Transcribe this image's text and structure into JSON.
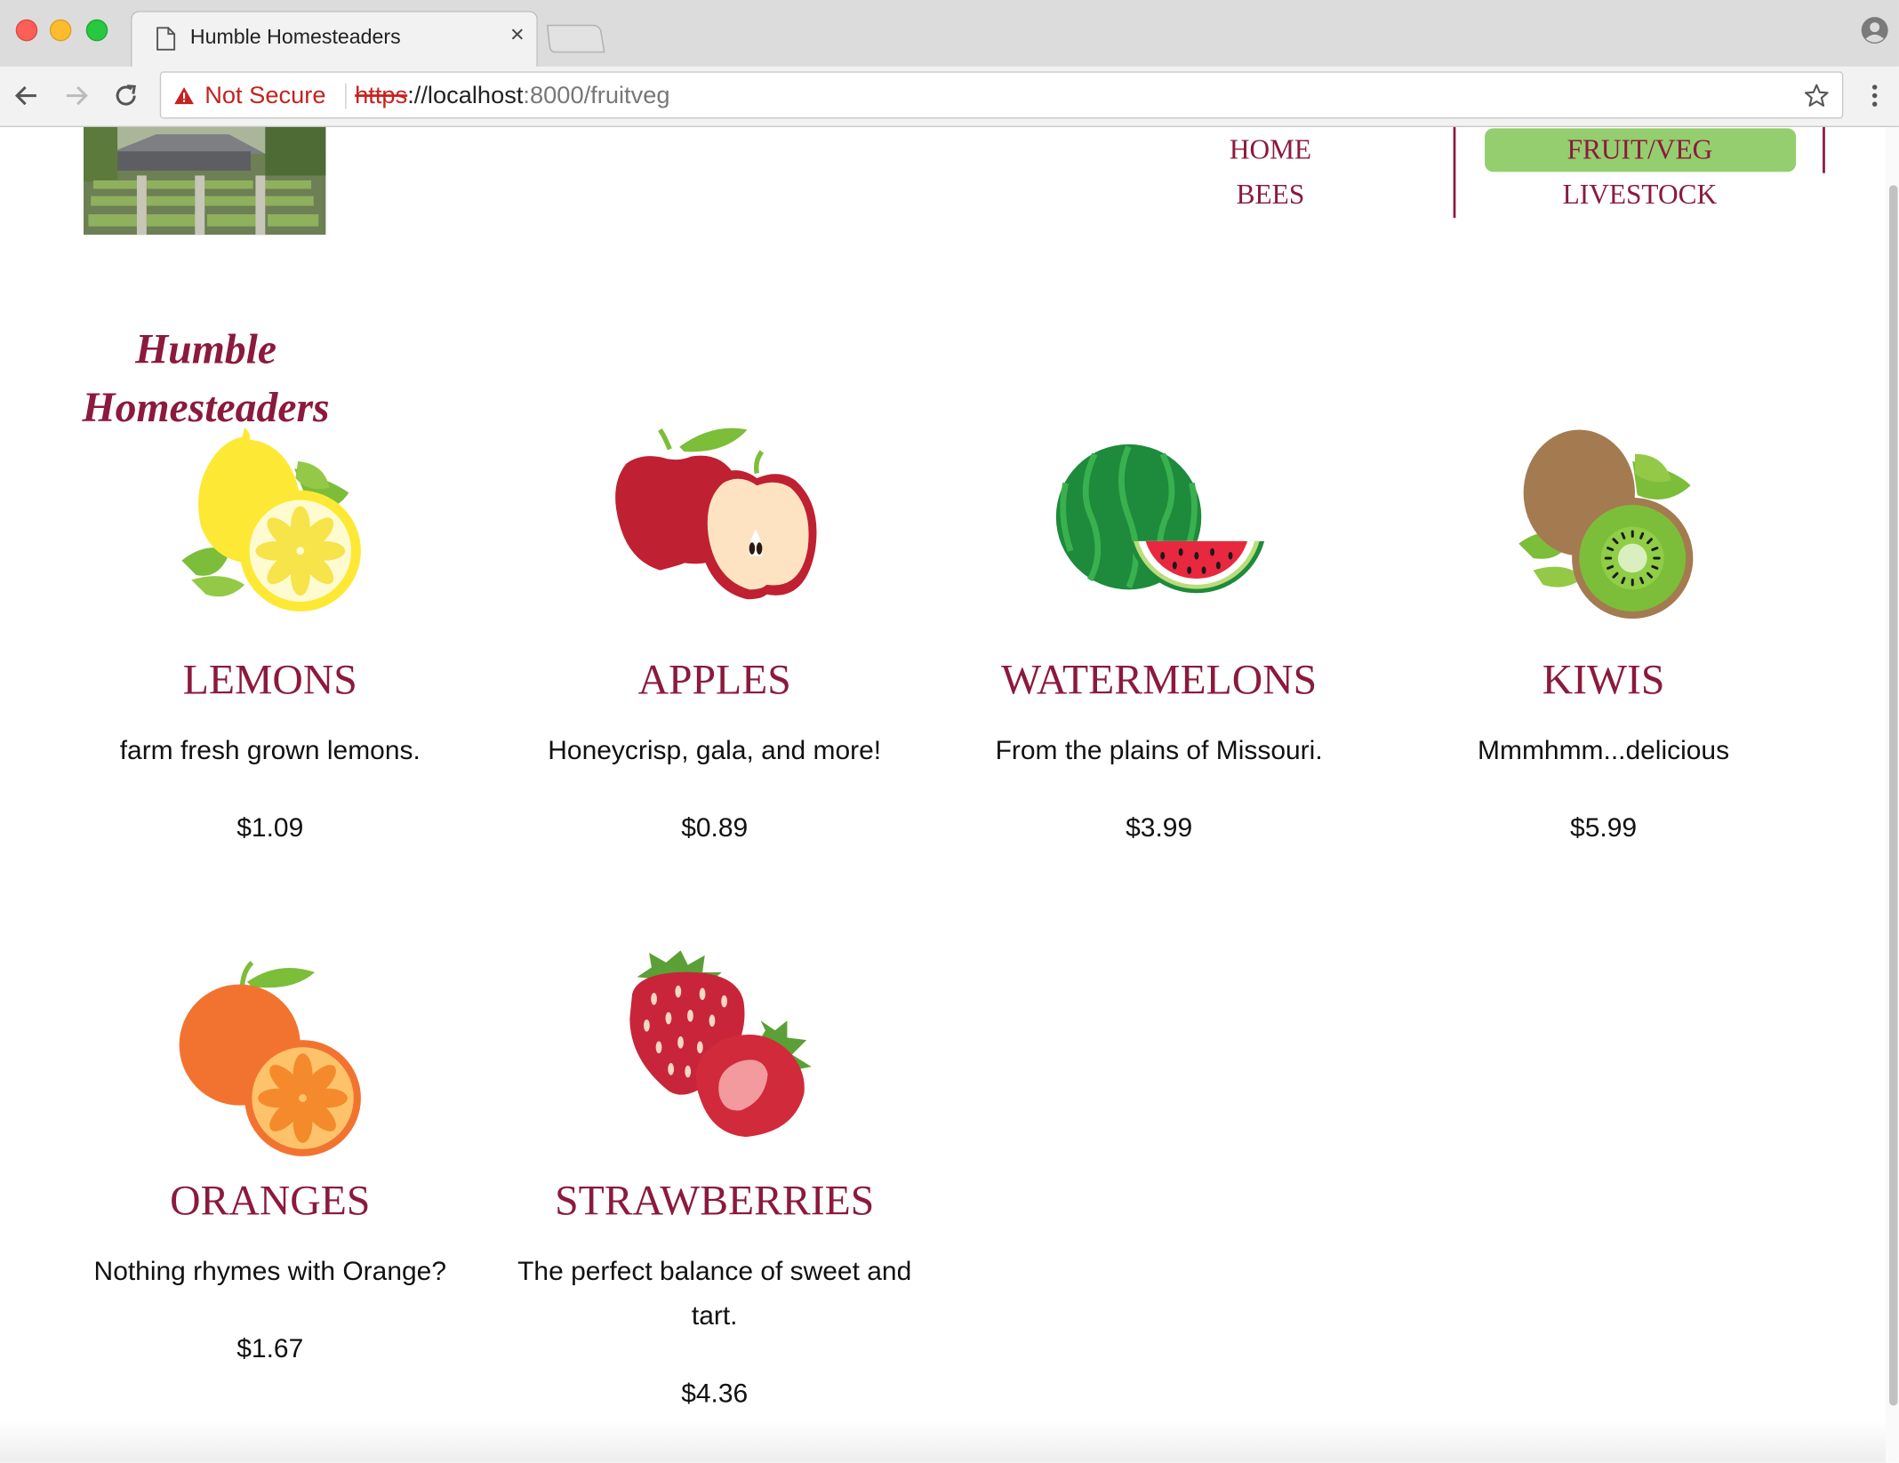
{
  "browser": {
    "tab_title": "Humble Homesteaders",
    "security_label": "Not Secure",
    "url_scheme": "https",
    "url_host": "://localhost",
    "url_rest": ":8000/fruitveg"
  },
  "nav": {
    "home": "HOME",
    "bees": "BEES",
    "fruitveg": "FRUIT/VEG",
    "livestock": "LIVESTOCK",
    "active": "FRUIT/VEG",
    "active_color": "#94ce6f",
    "link_color": "#8b1a3d"
  },
  "brand": {
    "line1": "Humble",
    "line2": "Homesteaders"
  },
  "products": [
    {
      "name": "LEMONS",
      "description": "farm fresh grown lemons.",
      "price": "$1.09",
      "icon": "lemon-icon"
    },
    {
      "name": "APPLES",
      "description": "Honeycrisp, gala, and more!",
      "price": "$0.89",
      "icon": "apple-icon"
    },
    {
      "name": "WATERMELONS",
      "description": "From the plains of Missouri.",
      "price": "$3.99",
      "icon": "watermelon-icon"
    },
    {
      "name": "KIWIS",
      "description": "Mmmhmm...delicious",
      "price": "$5.99",
      "icon": "kiwi-icon"
    },
    {
      "name": "ORANGES",
      "description": "Nothing rhymes with Orange?",
      "price": "$1.67",
      "icon": "orange-icon"
    },
    {
      "name": "STRAWBERRIES",
      "description": "The perfect balance of sweet and tart.",
      "price": "$4.36",
      "icon": "strawberry-icon"
    }
  ]
}
